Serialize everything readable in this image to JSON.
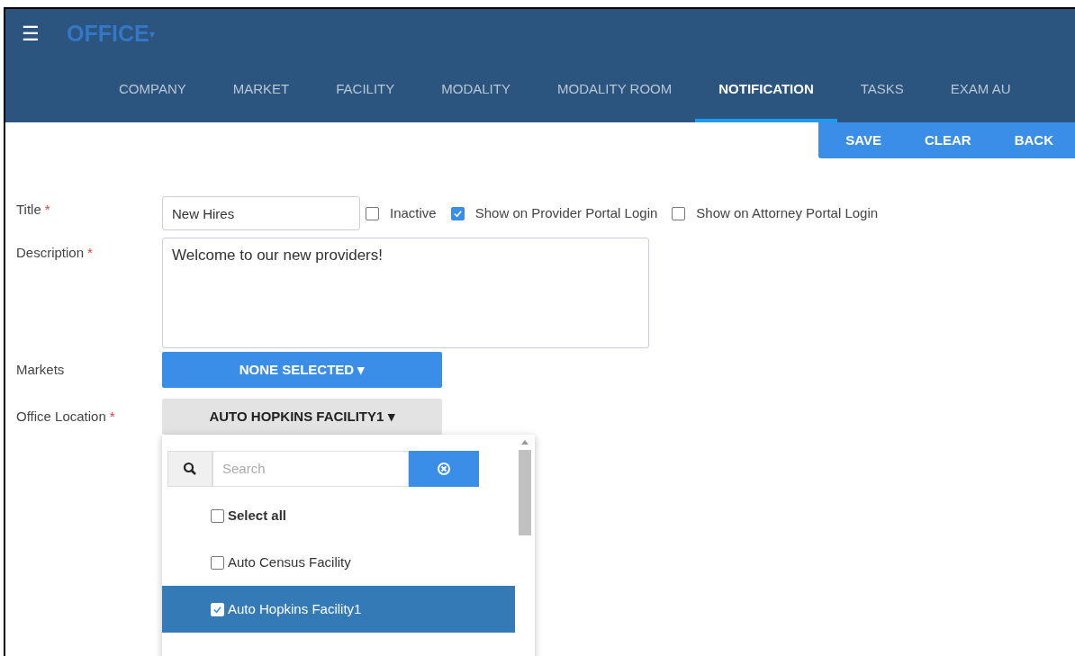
{
  "header": {
    "menu_icon": "☰",
    "title": "OFFICE",
    "caret": "▾"
  },
  "tabs": [
    {
      "label": "COMPANY",
      "selected": false
    },
    {
      "label": "MARKET",
      "selected": false
    },
    {
      "label": "FACILITY",
      "selected": false
    },
    {
      "label": "MODALITY",
      "selected": false
    },
    {
      "label": "MODALITY ROOM",
      "selected": false
    },
    {
      "label": "NOTIFICATION",
      "selected": true
    },
    {
      "label": "TASKS",
      "selected": false
    },
    {
      "label": "EXAM AU",
      "selected": false
    }
  ],
  "actions": [
    "SAVE",
    "CLEAR",
    "BACK"
  ],
  "form": {
    "title": {
      "label": "Title",
      "required_mark": "*",
      "value": "New Hires"
    },
    "options": [
      {
        "label": "Inactive",
        "checked": false
      },
      {
        "label": "Show on Provider Portal Login",
        "checked": true
      },
      {
        "label": "Show on Attorney Portal Login",
        "checked": false
      }
    ],
    "description": {
      "label": "Description",
      "required_mark": "*",
      "value": "Welcome to our new providers!"
    },
    "markets": {
      "label": "Markets",
      "value": "NONE SELECTED",
      "caret": "▾"
    },
    "office_location": {
      "label": "Office Location",
      "required_mark": "*",
      "value": "AUTO HOPKINS FACILITY1",
      "caret": "▾"
    }
  },
  "dropdown": {
    "search_placeholder": "Search",
    "items": [
      {
        "kind": "select_all",
        "label": "Select all",
        "checked": false,
        "selected": false
      },
      {
        "kind": "option",
        "label": "Auto Census Facility",
        "checked": false,
        "selected": false
      },
      {
        "kind": "option",
        "label": "Auto Hopkins Facility1",
        "checked": true,
        "selected": true
      }
    ]
  }
}
